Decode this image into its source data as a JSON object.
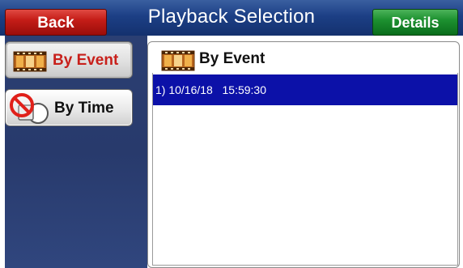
{
  "header": {
    "title": "Playback Selection",
    "back_label": "Back",
    "details_label": "Details",
    "colors": {
      "title_bar": "#1c3f85",
      "back_button": "#c51d18",
      "details_button": "#1d9130"
    }
  },
  "sidebar": {
    "items": [
      {
        "label": "By Event",
        "icon": "film-reel-icon",
        "selected": true,
        "label_color": "#c8201b"
      },
      {
        "label": "By Time",
        "icon": "no-clock-icon",
        "selected": false,
        "label_color": "#111111"
      }
    ]
  },
  "main": {
    "heading": "By Event",
    "heading_icon": "film-reel-icon",
    "list": [
      {
        "text": "1) 10/16/18   15:59:30",
        "selected": true
      }
    ],
    "selection_color": "#0c11a8"
  }
}
